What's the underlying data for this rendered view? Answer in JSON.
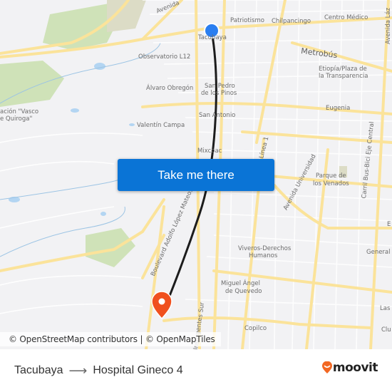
{
  "map": {
    "labels": {
      "avenida_top": "Avenida",
      "patriotismo": "Patriotismo",
      "chilpancingo": "Chilpancingo",
      "centro_medico": "Centro Médico",
      "avenida_right": "Avenida Láz",
      "tacubaya": "Tacubaya",
      "observatorio": "Observatorio L12",
      "metrobus": "Metrobús",
      "etiopia": "Etiopía/Plaza de",
      "etiopia2": "la Transparencia",
      "alvaro": "Álvaro Obregón",
      "san_pedro": "San Pedro",
      "san_pedro2": "de los Pinos",
      "vasco": "ación \"Vasco",
      "vasco2": "e Quiroga\"",
      "san_antonio": "San Antonio",
      "eugenia": "Eugenia",
      "valentin": "Valentín Campa",
      "metrobus_linea": "Metrobús Línea 1",
      "eje_central": "Carril Bus-Bici Eje Central",
      "mixcoac": "Mixcoac",
      "avenida_universidad": "Avenida Universidad",
      "parque_venados": "Parque de",
      "parque_venados2": "los Venados",
      "boulevard": "Boulevard Adolfo López Mateos",
      "viveros": "Viveros-Derechos",
      "viveros2": "Humanos",
      "general": "General A",
      "miguel_angel": "Miguel Ángel",
      "miguel_angel2": "de Quevedo",
      "insurgentes": "Insurgentes Sur",
      "las": "Las T",
      "copilco": "Copilco",
      "clu": "Clu",
      "e_right": "E"
    },
    "origin_marker": "origin-dot",
    "destination_marker": "destination-pin",
    "colors": {
      "route_line": "#1c1c1c",
      "origin": "#2a7ef0",
      "destination": "#f0501e",
      "road": "#fbe39a",
      "park": "#c9deb0",
      "water": "#a9d0f0"
    }
  },
  "cta": {
    "label": "Take me there",
    "color": "#0a74d6"
  },
  "attribution": {
    "osm": "© OpenStreetMap contributors",
    "separator": "|",
    "omt": "© OpenMapTiles"
  },
  "footer": {
    "origin": "Tacubaya",
    "arrow": "⟶",
    "destination": "Hospital Gineco 4",
    "brand": "moovit",
    "brand_color": "#f26722"
  }
}
